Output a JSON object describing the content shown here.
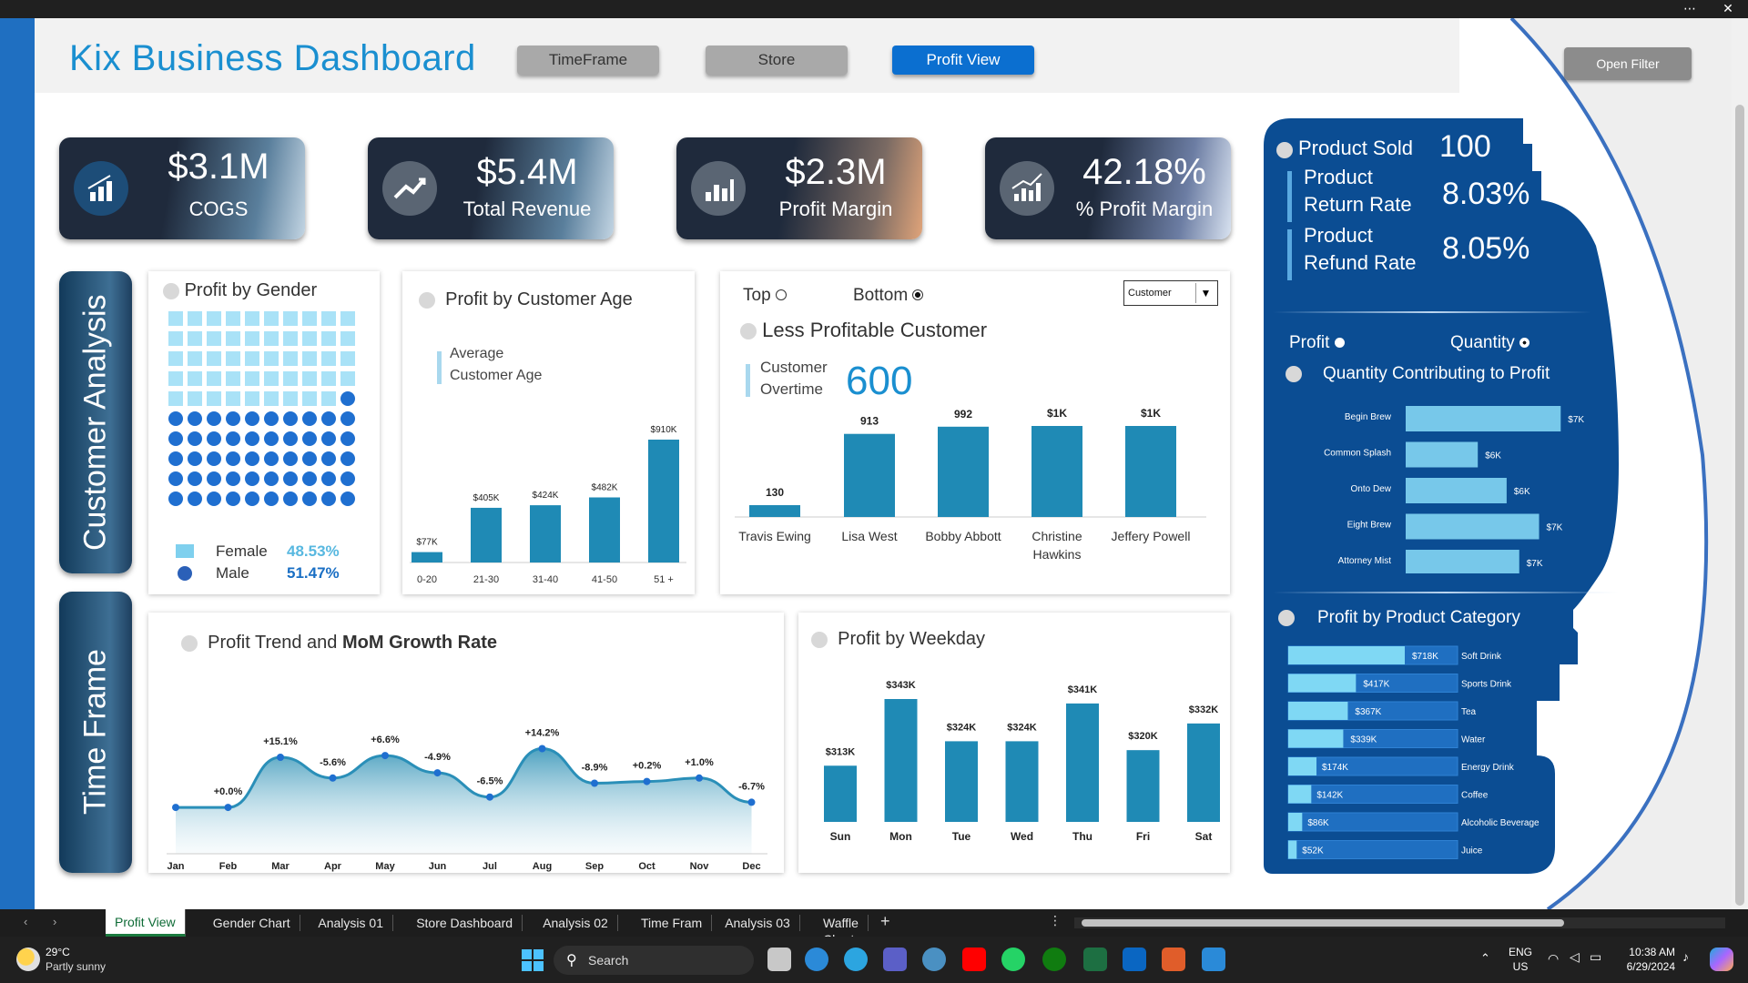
{
  "header": {
    "title": "Kix Business Dashboard",
    "nav": [
      "TimeFrame",
      "Store",
      "Profit View"
    ],
    "open_filter": "Open Filter"
  },
  "kpis": [
    {
      "value": "$3.1M",
      "label": "COGS"
    },
    {
      "value": "$5.4M",
      "label": "Total Revenue"
    },
    {
      "value": "$2.3M",
      "label": "Profit Margin"
    },
    {
      "value": "42.18%",
      "label": "% Profit Margin"
    }
  ],
  "side_labels": {
    "customer": "Customer Analysis",
    "time": "Time Frame"
  },
  "gender": {
    "title": "Profit by Gender",
    "female_label": "Female",
    "female_value": "48.53%",
    "male_label": "Male",
    "male_value": "51.47%",
    "female_cells": 49,
    "male_cells": 51
  },
  "age": {
    "title": "Profit by Customer Age",
    "subtitle_1": "Average",
    "subtitle_2": "Customer Age",
    "categories": [
      "0-20",
      "21-30",
      "31-40",
      "41-50",
      "51 +"
    ],
    "values": [
      77,
      405,
      424,
      482,
      910
    ],
    "labels": [
      "$77K",
      "$405K",
      "$424K",
      "$482K",
      "$910K"
    ]
  },
  "customer": {
    "top_label": "Top",
    "bottom_label": "Bottom",
    "dropdown": "Customer",
    "title": "Less Profitable Customer",
    "overtime_1": "Customer",
    "overtime_2": "Overtime",
    "overtime_value": "600",
    "categories": [
      "Travis Ewing",
      "Lisa West",
      "Bobby Abbott",
      "Christine Hawkins",
      "Jeffery Powell"
    ],
    "values": [
      130,
      913,
      992,
      1000,
      1000
    ],
    "labels": [
      "130",
      "913",
      "992",
      "$1K",
      "$1K"
    ]
  },
  "trend": {
    "title_pre": "Profit Trend and ",
    "title_bold": "MoM Growth Rate",
    "months": [
      "Jan",
      "Feb",
      "Mar",
      "Apr",
      "May",
      "Jun",
      "Jul",
      "Aug",
      "Sep",
      "Oct",
      "Nov",
      "Dec"
    ],
    "growth": [
      "",
      "+0.0%",
      "+15.1%",
      "-5.6%",
      "+6.6%",
      "-4.9%",
      "-6.5%",
      "+14.2%",
      "-8.9%",
      "+0.2%",
      "+1.0%",
      "-6.7%"
    ],
    "values": [
      191,
      191,
      220,
      208,
      221,
      211,
      197,
      225,
      205,
      206,
      208,
      194
    ]
  },
  "weekday": {
    "title": "Profit by Weekday",
    "days": [
      "Sun",
      "Mon",
      "Tue",
      "Wed",
      "Thu",
      "Fri",
      "Sat"
    ],
    "values": [
      313,
      343,
      324,
      324,
      341,
      320,
      332
    ],
    "labels": [
      "$313K",
      "$343K",
      "$324K",
      "$324K",
      "$341K",
      "$320K",
      "$332K"
    ]
  },
  "product_stats": {
    "sold_label": "Product Sold",
    "sold_value": "100",
    "return_label_1": "Product",
    "return_label_2": "Return Rate",
    "return_value": "8.03%",
    "refund_label_1": "Product",
    "refund_label_2": "Refund Rate",
    "refund_value": "8.05%"
  },
  "quantity": {
    "profit_opt": "Profit",
    "quantity_opt": "Quantity",
    "title": "Quantity Contributing to Profit",
    "items": [
      "Begin Brew",
      "Common Splash",
      "Onto Dew",
      "Eight Brew",
      "Attorney Mist"
    ],
    "values": [
      7,
      6,
      6,
      7,
      7
    ],
    "labels": [
      "$7K",
      "$6K",
      "$6K",
      "$7K",
      "$7K"
    ],
    "bar_fraction": [
      0.86,
      0.4,
      0.56,
      0.74,
      0.63
    ]
  },
  "category": {
    "title": "Profit by Product Category",
    "items": [
      "Soft Drink",
      "Sports Drink",
      "Tea",
      "Water",
      "Energy Drink",
      "Coffee",
      "Alcoholic Beverage",
      "Juice"
    ],
    "values": [
      718,
      417,
      367,
      339,
      174,
      142,
      86,
      52
    ],
    "labels": [
      "$718K",
      "$417K",
      "$367K",
      "$339K",
      "$174K",
      "$142K",
      "$86K",
      "$52K"
    ]
  },
  "tabs": [
    "Profit View",
    "Gender Chart",
    "Analysis 01",
    "Store Dashboard",
    "Analysis 02",
    "Time Fram",
    "Analysis 03",
    "Waffle Chart"
  ],
  "taskbar": {
    "temp": "29°C",
    "weather": "Partly sunny",
    "search": "Search",
    "lang1": "ENG",
    "lang2": "US",
    "time": "10:38 AM",
    "date": "6/29/2024"
  },
  "colors": {
    "bar": "#1f8ab5",
    "navy": "#0b4d93",
    "light_bar": "#7fd0ee",
    "accent": "#1a8fd0"
  }
}
